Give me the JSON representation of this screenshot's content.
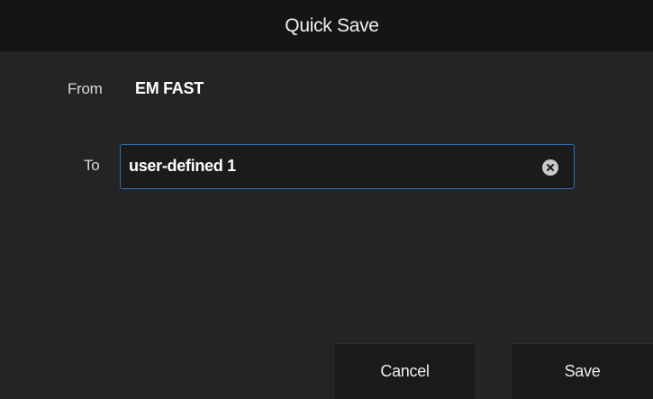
{
  "dialog": {
    "title": "Quick Save"
  },
  "from": {
    "label": "From",
    "value": "EM FAST"
  },
  "to": {
    "label": "To",
    "value": "user-defined 1",
    "clear_icon": "clear-circle-x-icon"
  },
  "buttons": {
    "cancel": "Cancel",
    "save": "Save"
  },
  "colors": {
    "background": "#242424",
    "titlebar": "#151515",
    "field_border": "#2f6fb5",
    "button_bg": "#1a1a1a"
  }
}
